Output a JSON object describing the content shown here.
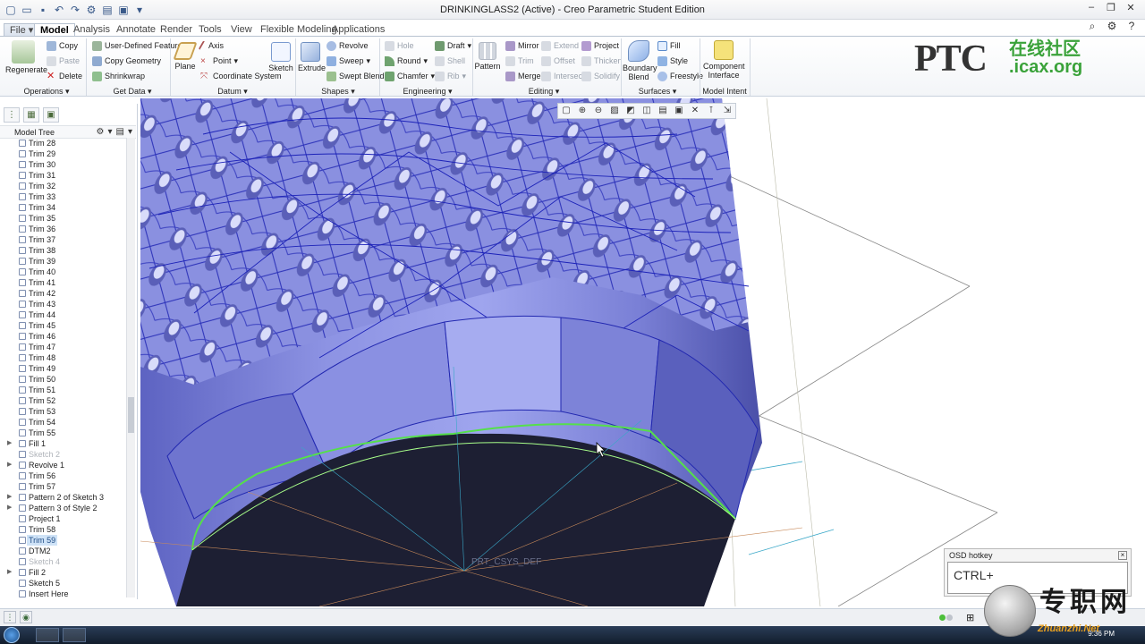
{
  "window": {
    "title": "DRINKINGLASS2 (Active) - Creo Parametric Student Edition"
  },
  "tabs": [
    {
      "label": "File ▾"
    },
    {
      "label": "Model"
    },
    {
      "label": "Analysis"
    },
    {
      "label": "Annotate"
    },
    {
      "label": "Render"
    },
    {
      "label": "Tools"
    },
    {
      "label": "View"
    },
    {
      "label": "Flexible Modeling"
    },
    {
      "label": "Applications"
    }
  ],
  "ribbon": {
    "regenerate": "Regenerate",
    "copy": "Copy",
    "paste": "Paste",
    "delete": "Delete",
    "user_defined_feature": "User-Defined Feature",
    "copy_geometry": "Copy Geometry",
    "shrinkwrap": "Shrinkwrap",
    "plane": "Plane",
    "axis": "Axis",
    "point": "Point",
    "coordinate_system": "Coordinate System",
    "sketch": "Sketch",
    "extrude": "Extrude",
    "revolve": "Revolve",
    "sweep": "Sweep",
    "swept_blend": "Swept Blend",
    "hole": "Hole",
    "round": "Round",
    "chamfer": "Chamfer",
    "draft": "Draft",
    "shell": "Shell",
    "rib": "Rib",
    "pattern": "Pattern",
    "mirror": "Mirror",
    "trim": "Trim",
    "merge": "Merge",
    "extend": "Extend",
    "offset": "Offset",
    "intersect": "Intersect",
    "project": "Project",
    "thicken": "Thicken",
    "solidify": "Solidify",
    "boundary_blend_1": "Boundary",
    "boundary_blend_2": "Blend",
    "fill": "Fill",
    "style": "Style",
    "freestyle": "Freestyle",
    "component_interface_1": "Component",
    "component_interface_2": "Interface",
    "groups": {
      "operations": "Operations ▾",
      "get_data": "Get Data ▾",
      "datum": "Datum ▾",
      "shapes": "Shapes ▾",
      "engineering": "Engineering ▾",
      "editing": "Editing ▾",
      "surfaces": "Surfaces ▾",
      "model_intent": "Model Intent ▾"
    }
  },
  "logo": {
    "main": "PTC",
    "cn": "在线社区",
    "url": ".icax.org"
  },
  "model_tree": {
    "title": "Model Tree",
    "items": [
      {
        "label": "Trim 28",
        "expand": "",
        "dim": false,
        "sel": false
      },
      {
        "label": "Trim 29",
        "expand": "",
        "dim": false,
        "sel": false
      },
      {
        "label": "Trim 30",
        "expand": "",
        "dim": false,
        "sel": false
      },
      {
        "label": "Trim 31",
        "expand": "",
        "dim": false,
        "sel": false
      },
      {
        "label": "Trim 32",
        "expand": "",
        "dim": false,
        "sel": false
      },
      {
        "label": "Trim 33",
        "expand": "",
        "dim": false,
        "sel": false
      },
      {
        "label": "Trim 34",
        "expand": "",
        "dim": false,
        "sel": false
      },
      {
        "label": "Trim 35",
        "expand": "",
        "dim": false,
        "sel": false
      },
      {
        "label": "Trim 36",
        "expand": "",
        "dim": false,
        "sel": false
      },
      {
        "label": "Trim 37",
        "expand": "",
        "dim": false,
        "sel": false
      },
      {
        "label": "Trim 38",
        "expand": "",
        "dim": false,
        "sel": false
      },
      {
        "label": "Trim 39",
        "expand": "",
        "dim": false,
        "sel": false
      },
      {
        "label": "Trim 40",
        "expand": "",
        "dim": false,
        "sel": false
      },
      {
        "label": "Trim 41",
        "expand": "",
        "dim": false,
        "sel": false
      },
      {
        "label": "Trim 42",
        "expand": "",
        "dim": false,
        "sel": false
      },
      {
        "label": "Trim 43",
        "expand": "",
        "dim": false,
        "sel": false
      },
      {
        "label": "Trim 44",
        "expand": "",
        "dim": false,
        "sel": false
      },
      {
        "label": "Trim 45",
        "expand": "",
        "dim": false,
        "sel": false
      },
      {
        "label": "Trim 46",
        "expand": "",
        "dim": false,
        "sel": false
      },
      {
        "label": "Trim 47",
        "expand": "",
        "dim": false,
        "sel": false
      },
      {
        "label": "Trim 48",
        "expand": "",
        "dim": false,
        "sel": false
      },
      {
        "label": "Trim 49",
        "expand": "",
        "dim": false,
        "sel": false
      },
      {
        "label": "Trim 50",
        "expand": "",
        "dim": false,
        "sel": false
      },
      {
        "label": "Trim 51",
        "expand": "",
        "dim": false,
        "sel": false
      },
      {
        "label": "Trim 52",
        "expand": "",
        "dim": false,
        "sel": false
      },
      {
        "label": "Trim 53",
        "expand": "",
        "dim": false,
        "sel": false
      },
      {
        "label": "Trim 54",
        "expand": "",
        "dim": false,
        "sel": false
      },
      {
        "label": "Trim 55",
        "expand": "",
        "dim": false,
        "sel": false
      },
      {
        "label": "Fill 1",
        "expand": "▶",
        "dim": false,
        "sel": false
      },
      {
        "label": "Sketch 2",
        "expand": "",
        "dim": true,
        "sel": false
      },
      {
        "label": "Revolve 1",
        "expand": "▶",
        "dim": false,
        "sel": false
      },
      {
        "label": "Trim 56",
        "expand": "",
        "dim": false,
        "sel": false
      },
      {
        "label": "Trim 57",
        "expand": "",
        "dim": false,
        "sel": false
      },
      {
        "label": "Pattern 2 of Sketch 3",
        "expand": "▶",
        "dim": false,
        "sel": false
      },
      {
        "label": "Pattern 3 of Style 2",
        "expand": "▶",
        "dim": false,
        "sel": false
      },
      {
        "label": "Project 1",
        "expand": "",
        "dim": false,
        "sel": false
      },
      {
        "label": "Trim 58",
        "expand": "",
        "dim": false,
        "sel": false
      },
      {
        "label": "Trim 59",
        "expand": "",
        "dim": false,
        "sel": true
      },
      {
        "label": "DTM2",
        "expand": "",
        "dim": false,
        "sel": false
      },
      {
        "label": "Sketch 4",
        "expand": "",
        "dim": true,
        "sel": false
      },
      {
        "label": "Fill 2",
        "expand": "▶",
        "dim": false,
        "sel": false
      },
      {
        "label": "Sketch 5",
        "expand": "",
        "dim": false,
        "sel": false
      },
      {
        "label": "Insert Here",
        "expand": "",
        "dim": false,
        "sel": false
      }
    ]
  },
  "viewport": {
    "csys_label": "PRT_CSYS_DEF"
  },
  "osd": {
    "title": "OSD hotkey",
    "text": "CTRL+"
  },
  "taskbar": {
    "clock": "9:36 PM"
  },
  "watermark": {
    "cn": "专职网",
    "url": "Zhuanzhi.Net"
  },
  "colors": {
    "surface": "#7b82d8",
    "edge": "#1c22b8",
    "highlight": "#55e04a",
    "opening": "#1d1f33"
  }
}
